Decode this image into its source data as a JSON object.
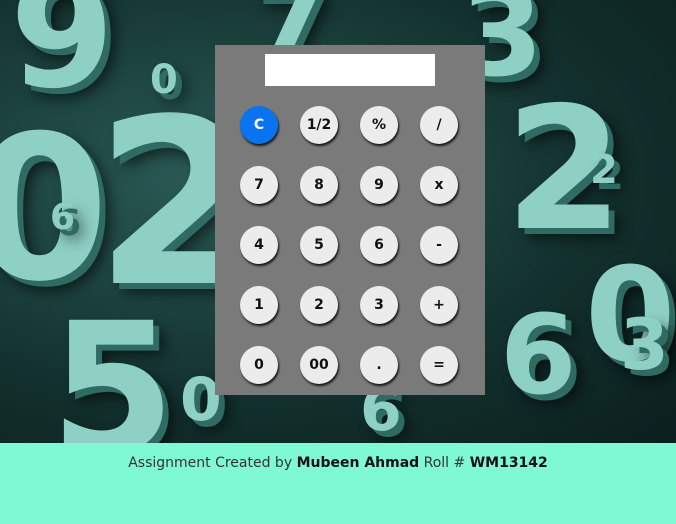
{
  "display": {
    "value": ""
  },
  "keys": [
    [
      "C",
      "1/2",
      "%",
      "/"
    ],
    [
      "7",
      "8",
      "9",
      "x"
    ],
    [
      "4",
      "5",
      "6",
      "-"
    ],
    [
      "1",
      "2",
      "3",
      "+"
    ],
    [
      "0",
      "00",
      ".",
      "="
    ]
  ],
  "footer": {
    "prefix": "Assignment Created by",
    "author": "Mubeen Ahmad",
    "roll_label": "Roll #",
    "roll_number": "WM13142"
  },
  "colors": {
    "clear_key": "#0a74f0",
    "calculator_body": "#7a7a7a",
    "footer_background": "#7ff9d2"
  }
}
